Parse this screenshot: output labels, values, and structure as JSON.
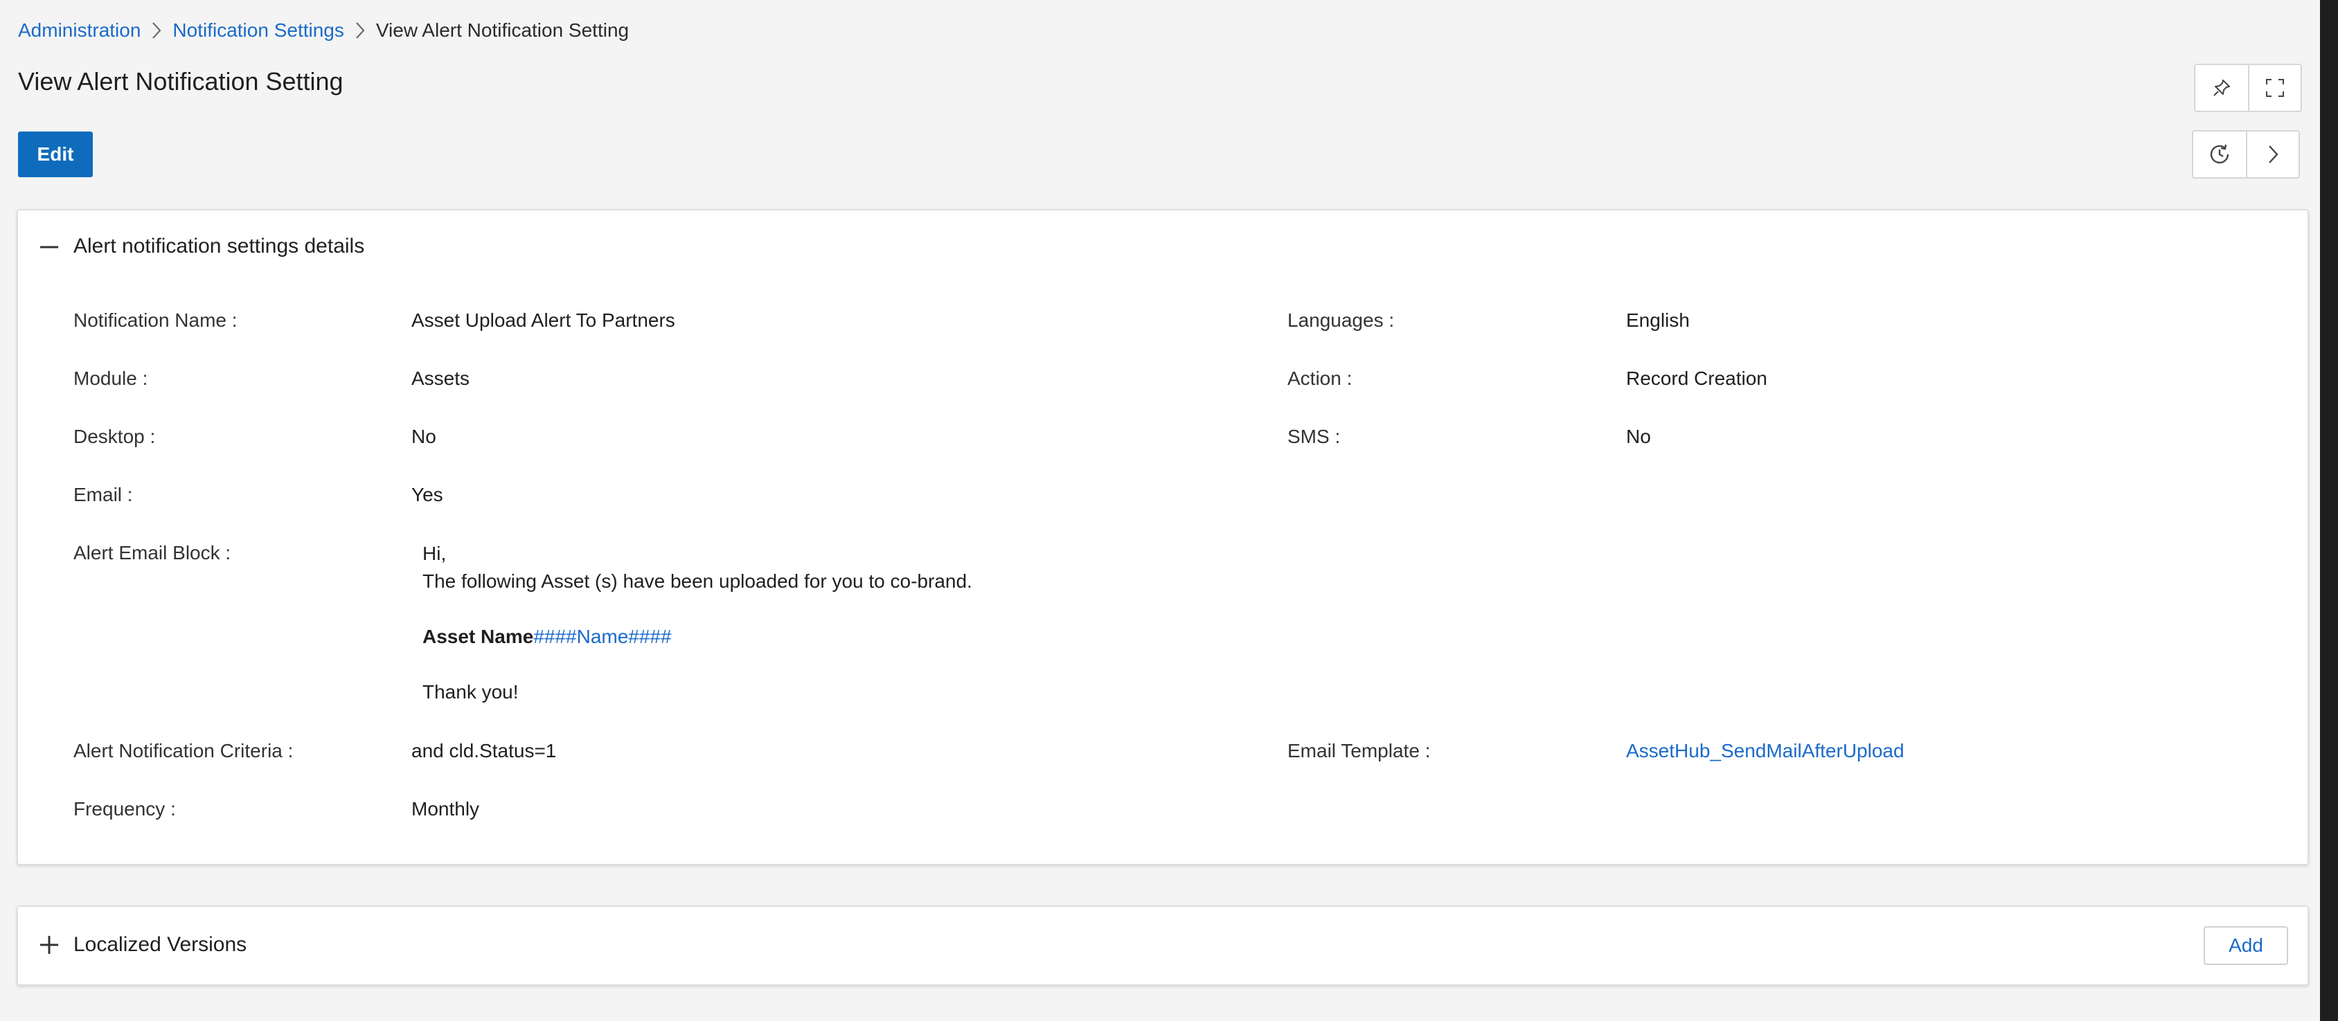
{
  "breadcrumb": {
    "items": [
      {
        "label": "Administration"
      },
      {
        "label": "Notification Settings"
      },
      {
        "label": "View Alert Notification Setting"
      }
    ]
  },
  "page": {
    "title": "View Alert Notification Setting",
    "edit_label": "Edit"
  },
  "toolbar": {
    "top_icons": [
      "pin-icon",
      "fullscreen-icon"
    ],
    "bottom_icons": [
      "history-icon",
      "chevron-right-icon"
    ]
  },
  "details": {
    "title": "Alert notification settings details",
    "fields": {
      "notification_name": {
        "label": "Notification Name :",
        "value": "Asset Upload Alert To Partners"
      },
      "languages": {
        "label": "Languages :",
        "value": "English"
      },
      "module": {
        "label": "Module :",
        "value": "Assets"
      },
      "action": {
        "label": "Action :",
        "value": "Record Creation"
      },
      "desktop": {
        "label": "Desktop :",
        "value": "No"
      },
      "sms": {
        "label": "SMS :",
        "value": "No"
      },
      "email": {
        "label": "Email :",
        "value": "Yes"
      },
      "alert_email_block": {
        "label": "Alert Email Block :"
      },
      "criteria": {
        "label": "Alert Notification Criteria :",
        "value": "and cld.Status=1"
      },
      "email_template": {
        "label": "Email Template :",
        "value": "AssetHub_SendMailAfterUpload"
      },
      "frequency": {
        "label": "Frequency :",
        "value": "Monthly"
      }
    },
    "email_block": {
      "greeting": "Hi,",
      "body": "The following Asset (s) have been uploaded for you to co-brand.",
      "asset_name_label": "Asset Name",
      "asset_name_token": "####Name####",
      "closing": "Thank you!"
    }
  },
  "localized": {
    "title": "Localized Versions",
    "add_label": "Add"
  },
  "colors": {
    "primary": "#0f6cbd",
    "link": "#1b6ac9",
    "background": "#f4f4f4"
  }
}
